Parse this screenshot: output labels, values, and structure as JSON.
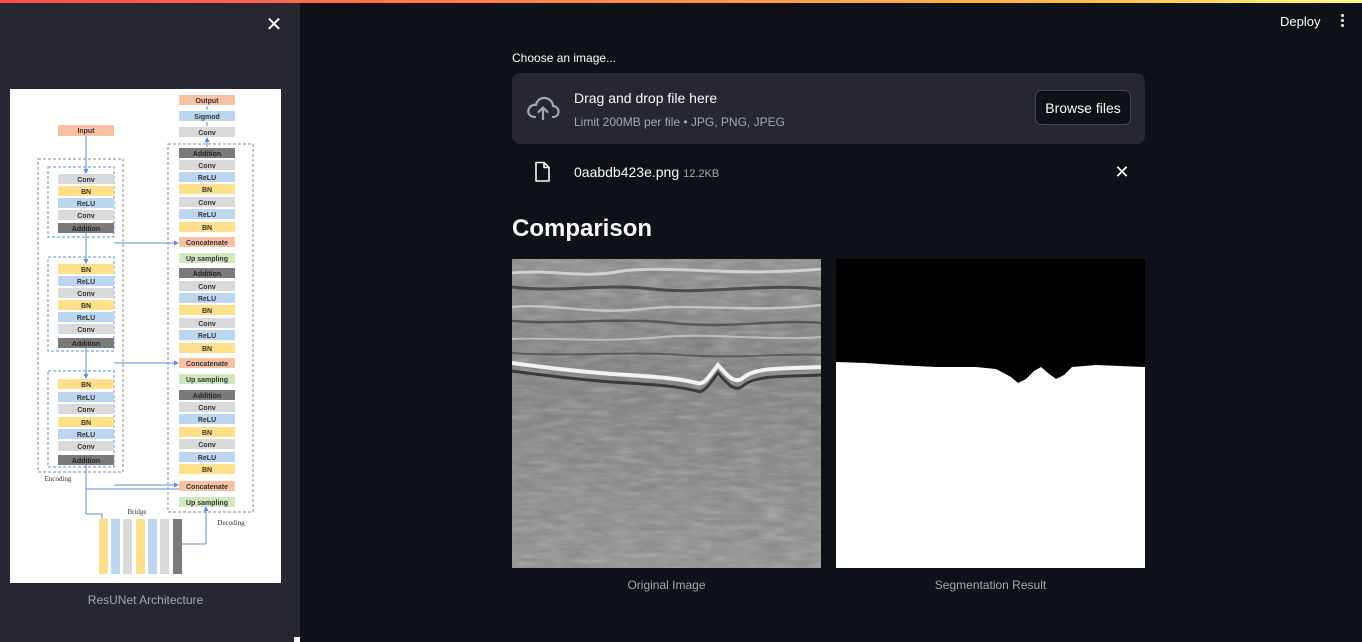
{
  "sidebar": {
    "close_icon": "close-icon",
    "caption": "ResUNet Architecture",
    "architecture": {
      "output": "Output",
      "sigmoid": "Sigmod",
      "input": "Input",
      "conv": "Conv",
      "bn": "BN",
      "relu": "ReLU",
      "addition": "Addition",
      "concatenate": "Concatenate",
      "up_sampling": "Up sampling",
      "encoding": "Encoding",
      "decoding": "Decoding",
      "bridge": "Bridge"
    }
  },
  "header": {
    "deploy_label": "Deploy",
    "menu_icon": "kebab-menu-icon"
  },
  "uploader": {
    "label": "Choose an image...",
    "drop_title": "Drag and drop file here",
    "drop_subtitle": "Limit 200MB per file • JPG, PNG, JPEG",
    "browse_label": "Browse files",
    "file": {
      "name": "0aabdb423e.png",
      "size": "12.2KB"
    }
  },
  "comparison": {
    "title": "Comparison",
    "original_caption": "Original Image",
    "segmentation_caption": "Segmentation Result"
  },
  "colors": {
    "background": "#0e1117",
    "sidebar": "#262730",
    "accent_gradient_start": "#ff4b4b",
    "accent_gradient_end": "#fffd80"
  }
}
